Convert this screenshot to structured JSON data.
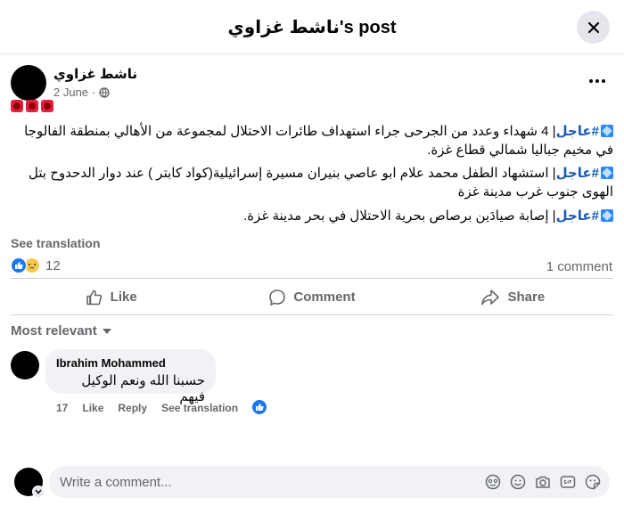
{
  "header": {
    "title": "ناشط غزاوي's post"
  },
  "post": {
    "author": "ناشط غزاوي",
    "date": "2 June",
    "dot": "·",
    "paragraphs": [
      {
        "tag": "#عاجل",
        "sep": "|",
        "text": " 4 شهداء وعدد من الجرحى جراء استهداف طائرات الاحتلال لمجموعة من الأهالي بمنطقة الفالوجا في مخيم جباليا شمالي قطاع غزة."
      },
      {
        "tag": "#عاجل",
        "sep": "|",
        "text": " استشهاد الطفل محمد علام ابو عاصي بنيران مسيرة إسرائيلية(كواد كابتر ) عند دوار الدحدوح بتل الهوى جنوب غرب مدينة غزة"
      },
      {
        "tag": "#عاجل",
        "sep": "|",
        "text": " إصابة صيادَين برصاص بحرية الاحتلال في بحر مدينة غزة."
      }
    ],
    "see_translation": "See translation",
    "reaction_count": "12",
    "comment_count": "1 comment"
  },
  "actions": {
    "like": "Like",
    "comment": "Comment",
    "share": "Share"
  },
  "comments_filter": "Most relevant",
  "comment": {
    "author": "Ibrahim Mohammed",
    "text": "حسبنا الله ونعم الوكيل فيهم",
    "age": "17",
    "like": "Like",
    "reply": "Reply",
    "see_translation": "See translation"
  },
  "composer": {
    "placeholder": "Write a comment..."
  },
  "colors": {
    "accent": "#1877f2",
    "muted": "#65676b",
    "bubble": "#f0f2f5"
  }
}
